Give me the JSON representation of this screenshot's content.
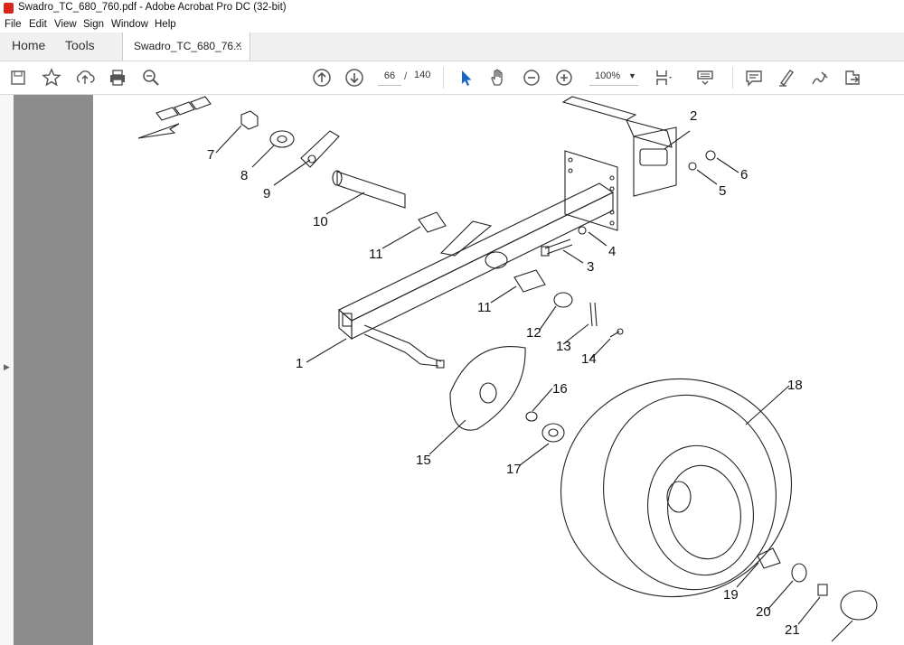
{
  "window": {
    "title": "Swadro_TC_680_760.pdf - Adobe Acrobat Pro DC (32-bit)"
  },
  "menu": [
    "File",
    "Edit",
    "View",
    "Sign",
    "Window",
    "Help"
  ],
  "tabs": {
    "home": "Home",
    "tools": "Tools",
    "document": "Swadro_TC_680_76...",
    "close": "×"
  },
  "toolbar": {
    "page_current": "66",
    "page_separator": "/",
    "page_total": "140",
    "zoom": "100%"
  },
  "callouts": [
    "1",
    "2",
    "3",
    "4",
    "5",
    "6",
    "7",
    "8",
    "9",
    "10",
    "11",
    "11",
    "12",
    "13",
    "14",
    "15",
    "16",
    "17",
    "18",
    "19",
    "20",
    "21"
  ],
  "icons": [
    "save-icon",
    "star-icon",
    "upload-icon",
    "print-icon",
    "zoom-search-icon",
    "page-up-icon",
    "page-down-icon",
    "select-arrow-icon",
    "hand-icon",
    "zoom-out-icon",
    "zoom-in-icon",
    "page-fit-icon",
    "keyboard-icon",
    "comment-icon",
    "highlight-pen-icon",
    "sign-icon",
    "share-icon"
  ],
  "colors": {
    "acrobat_red": "#d9261c",
    "select_blue": "#1a64c8",
    "gray_sidebar": "#8c8c8c"
  }
}
